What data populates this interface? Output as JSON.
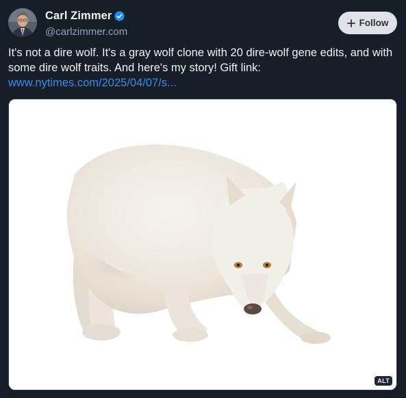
{
  "author": {
    "display_name": "Carl Zimmer",
    "handle": "@carlzimmer.com",
    "verified": true,
    "avatar_icon": "person-portrait"
  },
  "follow_button": {
    "label": "Follow",
    "icon": "plus-icon"
  },
  "post": {
    "text": "It's not a dire wolf. It's a gray wolf clone with 20 dire-wolf gene edits, and with some dire wolf traits. And here's my story! Gift link:",
    "link_text": "www.nytimes.com/2025/04/07/s..."
  },
  "media": {
    "subject": "white wolf",
    "alt_badge": "ALT"
  },
  "colors": {
    "background": "#161e27",
    "link": "#2f8df7",
    "verified": "#1d8cf8",
    "follow_bg": "#dfe3e8"
  }
}
